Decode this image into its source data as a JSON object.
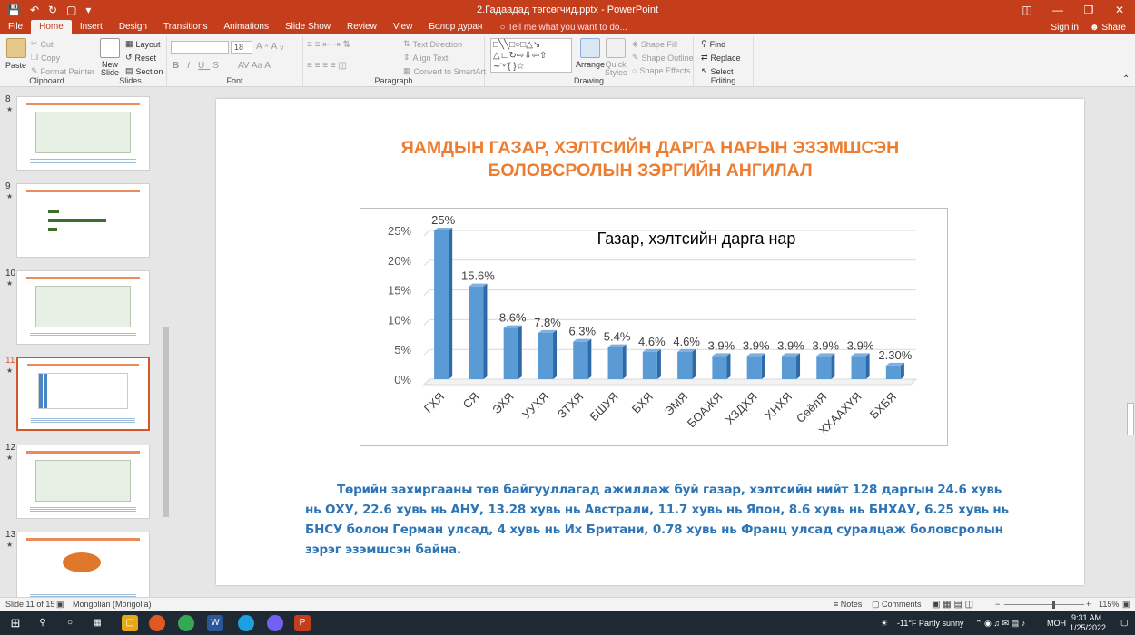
{
  "app": {
    "title": "2.Гадаадад төгсөгчид.pptx - PowerPoint",
    "qat_icons": [
      "save-icon",
      "undo-icon",
      "redo-icon",
      "present-icon",
      "customize-icon"
    ]
  },
  "ribbon": {
    "tabs": [
      "File",
      "Home",
      "Insert",
      "Design",
      "Transitions",
      "Animations",
      "Slide Show",
      "Review",
      "View",
      "Болор дуран"
    ],
    "active_tab": "Home",
    "tell_me": "Tell me what you want to do...",
    "sign_in": "Sign in",
    "share": "Share",
    "groups": {
      "clipboard": {
        "label": "Clipboard",
        "paste": "Paste",
        "cut": "Cut",
        "copy": "Copy",
        "format_painter": "Format Painter"
      },
      "slides": {
        "label": "Slides",
        "new_slide": "New Slide",
        "layout": "Layout",
        "reset": "Reset",
        "section": "Section"
      },
      "font": {
        "label": "Font",
        "font_name": "",
        "font_size": "18"
      },
      "paragraph": {
        "label": "Paragraph",
        "text_direction": "Text Direction",
        "align_text": "Align Text",
        "convert_smartart": "Convert to SmartArt"
      },
      "drawing": {
        "label": "Drawing",
        "arrange": "Arrange",
        "quick_styles": "Quick Styles",
        "shape_fill": "Shape Fill",
        "shape_outline": "Shape Outline",
        "shape_effects": "Shape Effects"
      },
      "editing": {
        "label": "Editing",
        "find": "Find",
        "replace": "Replace",
        "select": "Select"
      }
    }
  },
  "thumbnails": [
    {
      "num": "8",
      "star": "★"
    },
    {
      "num": "9",
      "star": "★"
    },
    {
      "num": "10",
      "star": "★"
    },
    {
      "num": "11",
      "star": "★",
      "active": true
    },
    {
      "num": "12",
      "star": "★"
    },
    {
      "num": "13",
      "star": "★"
    }
  ],
  "slide": {
    "title_line1": "ЯАМДЫН ГАЗАР, ХЭЛТСИЙН ДАРГА НАРЫН ЭЗЭМШСЭН",
    "title_line2": "БОЛОВСРОЛЫН ЗЭРГИЙН АНГИЛАЛ",
    "paragraph": "Төрийн захиргааны төв байгууллагад ажиллаж буй газар, хэлтсийн нийт 128 даргын 24.6 хувь нь ОХУ, 22.6 хувь нь АНУ, 13.28 хувь нь Австрали, 11.7 хувь нь Япон, 8.6 хувь нь БНХАУ, 6.25 хувь нь БНСУ болон Герман улсад, 4 хувь нь Их Британи, 0.78  хувь нь Франц улсад суралцаж боловсролын зэрэг эзэмшсэн байна."
  },
  "chart_data": {
    "type": "bar",
    "title": "Газар, хэлтсийн дарга нар",
    "categories": [
      "ГХЯ",
      "СЯ",
      "ЭХЯ",
      "УУХЯ",
      "ЗТХЯ",
      "БШУЯ",
      "БХЯ",
      "ЭМЯ",
      "БОАЖЯ",
      "ХЗДХЯ",
      "ХНХЯ",
      "СөёлЯ",
      "ХХААХҮЯ",
      "БХБЯ"
    ],
    "values": [
      25,
      15.6,
      8.6,
      7.8,
      6.3,
      5.4,
      4.6,
      4.6,
      3.9,
      3.9,
      3.9,
      3.9,
      3.9,
      2.3
    ],
    "data_labels": [
      "25%",
      "15.6%",
      "8.6%",
      "7.8%",
      "6.3%",
      "5.4%",
      "4.6%",
      "4.6%",
      "3.9%",
      "3.9%",
      "3.9%",
      "3.9%",
      "3.9%",
      "2.30%"
    ],
    "ylim": [
      0,
      25
    ],
    "yticks": [
      "0%",
      "5%",
      "10%",
      "15%",
      "20%",
      "25%"
    ],
    "xlabel": "",
    "ylabel": "",
    "grid": true,
    "bar_color": "#5b9bd5",
    "bar_style": "3d"
  },
  "status": {
    "slide_info": "Slide 11 of 15",
    "language": "Mongolian (Mongolia)",
    "notes": "Notes",
    "comments": "Comments",
    "zoom": "115%"
  },
  "taskbar": {
    "weather": "-11°F  Partly sunny",
    "lang": "МОН",
    "time": "9:31 AM",
    "date": "1/25/2022"
  },
  "colors": {
    "accent": "#c43e1c",
    "title_orange": "#ed7d31",
    "text_blue": "#2e75b6"
  }
}
